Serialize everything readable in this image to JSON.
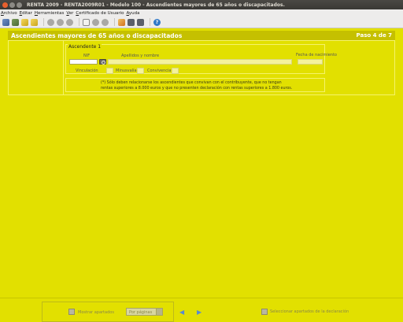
{
  "window": {
    "title": "RENTA 2009 - RENTA2009R01 - Modelo 100 - Ascendientes mayores de 65 años o discapacitados."
  },
  "menu": {
    "items": [
      "Archivo",
      "Editar",
      "Herramientas",
      "Ver",
      "Certificado de Usuario",
      "Ayuda"
    ]
  },
  "toolbar": {
    "icons": [
      "open-icon",
      "edit-icon",
      "save-icon",
      "disk-icon",
      "circle-icon",
      "circle-icon",
      "circle-icon",
      "doc-icon",
      "circle-icon",
      "circle-icon",
      "note-icon",
      "calendar-icon",
      "calendar-icon",
      "help-icon"
    ],
    "help_glyph": "?"
  },
  "header": {
    "title": "Ascendientes mayores de 65 años o discapacitados",
    "step": "Paso 4 de 7"
  },
  "form": {
    "legend": "Ascendente 1",
    "nif_label": "NIF",
    "apellidos_label": "Apellidos y nombre",
    "fecha_label": "Fecha de nacimiento",
    "nif_value": "",
    "apellidos_value": "",
    "fecha_value": "",
    "vinculacion_label": "Vinculación",
    "minusvalia_label": "Minusvalía",
    "convivencia_label": "Convivencia"
  },
  "note": {
    "line1": "(*) Sólo deben relacionarse los ascendientes que convivan con el contribuyente, que no tengan",
    "line2": "rentas superiores a 8.000 euros y que no presenten declaración con rentas superiores a 1.800 euros."
  },
  "bottom": {
    "mostrar_label": "Mostrar apartados",
    "paginas_value": "Por páginas",
    "prev_glyph": "◀",
    "next_glyph": "▶",
    "seleccionar_label": "Seleccionar apartados de la declaración"
  },
  "colors": {
    "background": "#e2e000",
    "header_bar": "#c5c000",
    "input_fill": "#f4f29c"
  }
}
